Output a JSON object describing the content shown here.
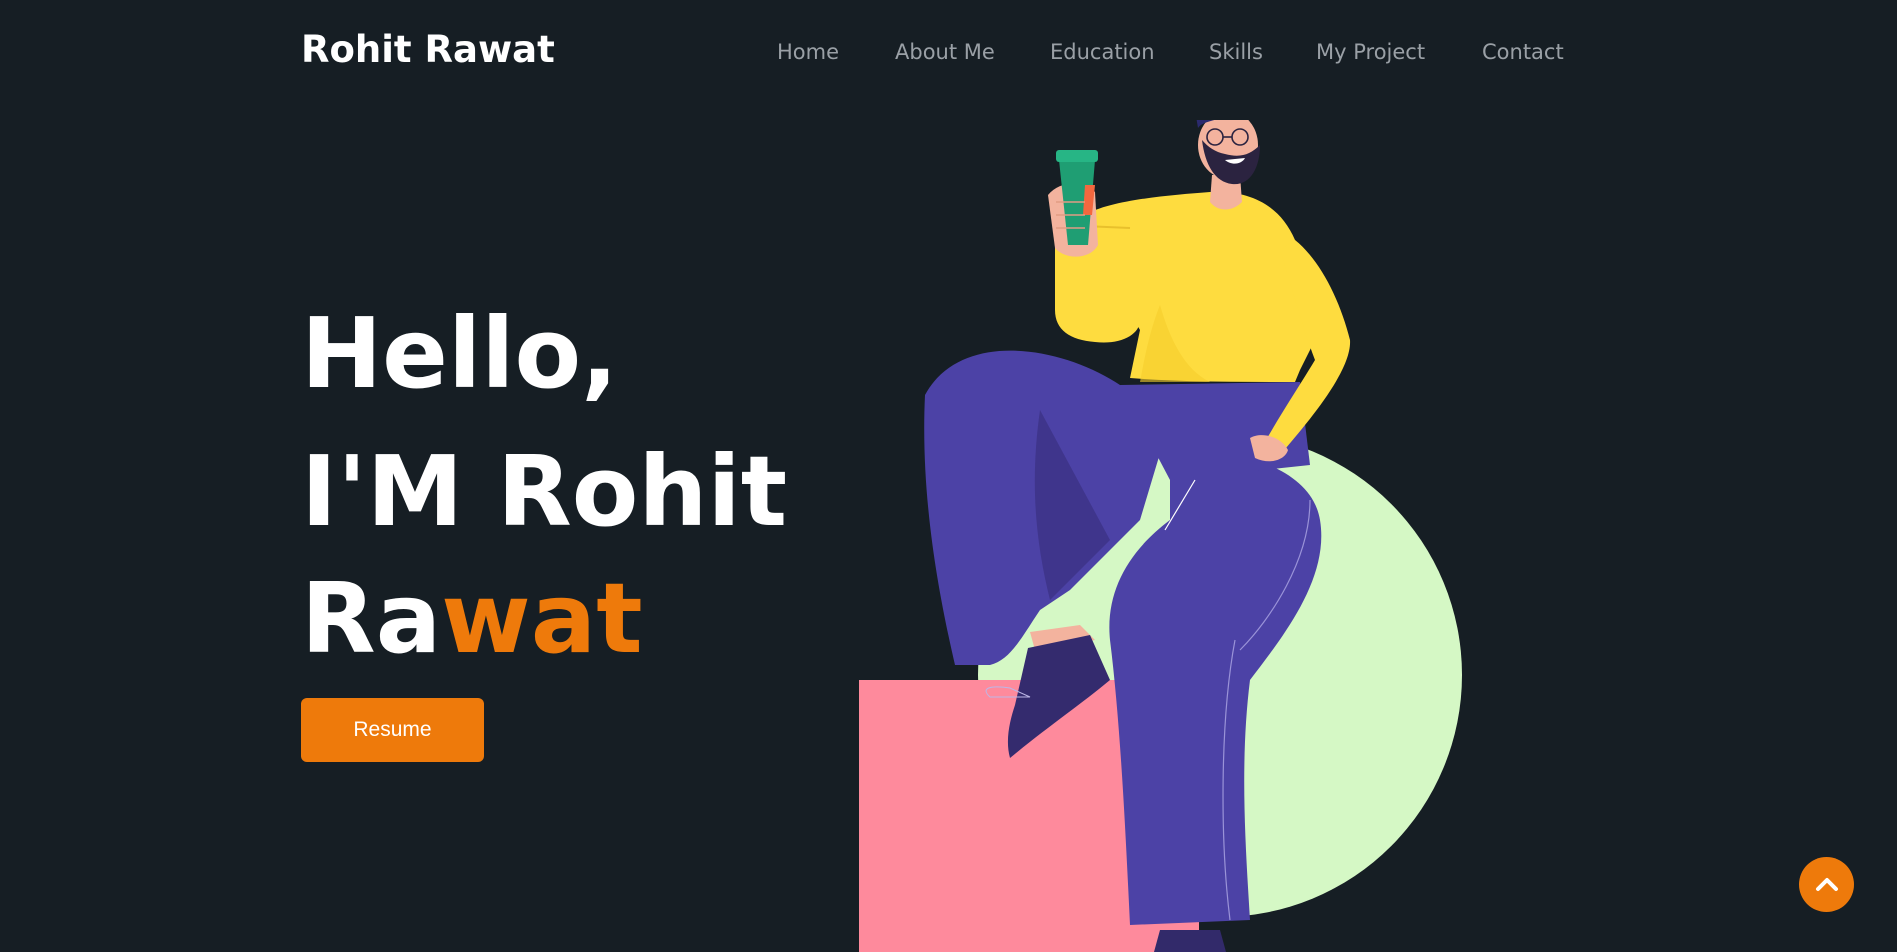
{
  "brand": {
    "name": "Rohit Rawat"
  },
  "nav": {
    "items": [
      {
        "label": "Home"
      },
      {
        "label": "About Me"
      },
      {
        "label": "Education"
      },
      {
        "label": "Skills"
      },
      {
        "label": "My Project"
      },
      {
        "label": "Contact"
      }
    ]
  },
  "hero": {
    "line1": "Hello,",
    "line2": "I'M Rohit",
    "line3_plain": "Ra",
    "line3_accent": "wat",
    "resume_label": "Resume"
  },
  "colors": {
    "background": "#161e24",
    "accent": "#ee7a0b",
    "nav_text": "#9aa0a6",
    "heading_text": "#ffffff"
  },
  "icons": {
    "scroll_top": "chevron-up-icon",
    "illustration": "person-with-coffee-illustration"
  }
}
